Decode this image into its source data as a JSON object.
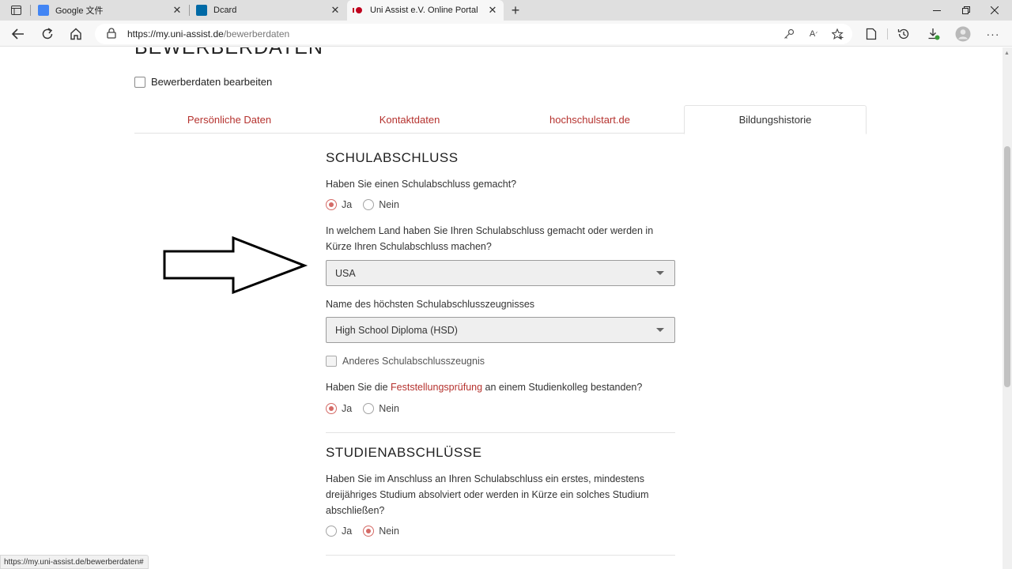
{
  "browser": {
    "tabs": [
      {
        "title": "Google 文件",
        "favicon_color": "#4285f4"
      },
      {
        "title": "Dcard",
        "favicon_color": "#006aa6"
      },
      {
        "title": "Uni Assist e.V. Online Portal",
        "favicon_color": "#c0001e"
      }
    ],
    "url_domain": "https://my.uni-assist.de",
    "url_path": "/bewerberdaten",
    "status_url": "https://my.uni-assist.de/bewerberdaten#"
  },
  "page": {
    "heading": "BEWERBERDATEN",
    "edit_checkbox_label": "Bewerberdaten bearbeiten",
    "nav_tabs": [
      "Persönliche Daten",
      "Kontaktdaten",
      "hochschulstart.de",
      "Bildungshistorie"
    ],
    "accent_color": "#b5322e"
  },
  "schulabschluss": {
    "title": "SCHULABSCHLUSS",
    "q1": "Haben Sie einen Schulabschluss gemacht?",
    "q1_options": [
      "Ja",
      "Nein"
    ],
    "q1_selected": "Ja",
    "q2": "In welchem Land haben Sie Ihren Schulabschluss gemacht oder werden in Kürze Ihren Schulabschluss machen?",
    "country_value": "USA",
    "q3": "Name des höchsten Schulabschlusszeugnisses",
    "diploma_value": "High School Diploma (HSD)",
    "other_checkbox_label": "Anderes Schulabschlusszeugnis",
    "q4_prefix": "Haben Sie die ",
    "q4_link": "Feststellungsprüfung",
    "q4_suffix": " an einem Studienkolleg bestanden?",
    "q4_options": [
      "Ja",
      "Nein"
    ],
    "q4_selected": "Ja"
  },
  "studienabschluesse": {
    "title": "STUDIENABSCHLÜSSE",
    "q1": "Haben Sie im Anschluss an Ihren Schulabschluss ein erstes, mindestens dreijähriges Studium absolviert oder werden in Kürze ein solches Studium abschließen?",
    "q1_options": [
      "Ja",
      "Nein"
    ],
    "q1_selected": "Nein"
  }
}
